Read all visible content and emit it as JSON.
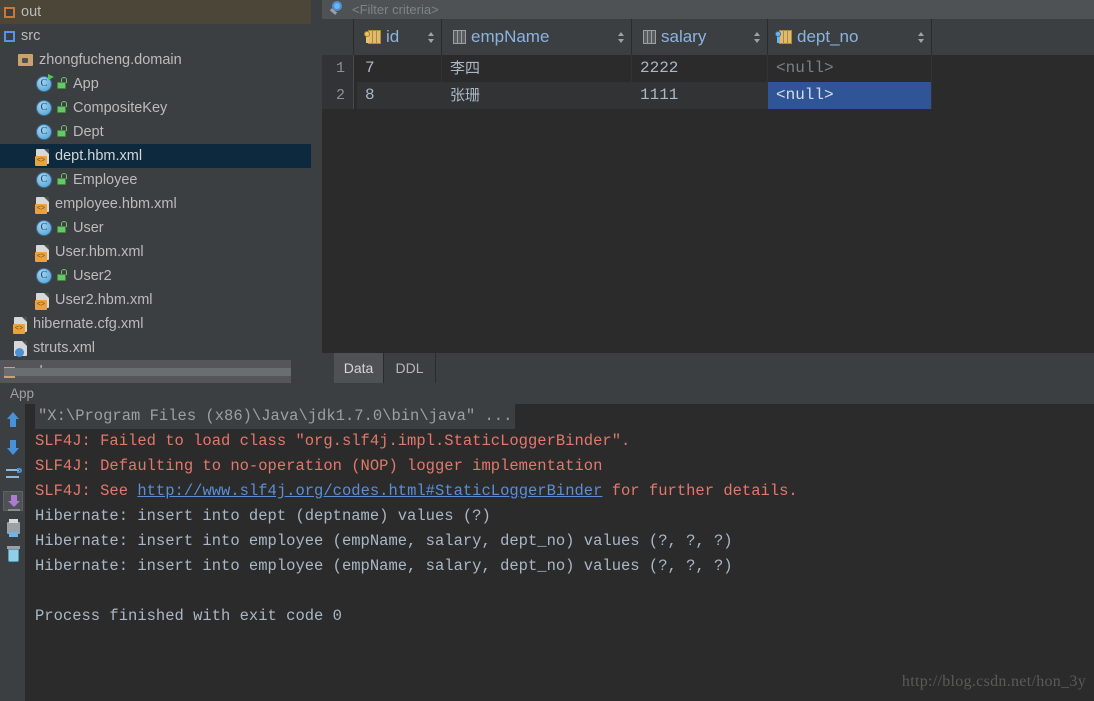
{
  "tree": {
    "items": [
      {
        "label": "out",
        "icon": "module-icon",
        "indent": 0,
        "state": "module"
      },
      {
        "label": "src",
        "icon": "module-icon-blue",
        "indent": 0,
        "state": "normal"
      },
      {
        "label": "zhongfucheng.domain",
        "icon": "package-icon",
        "indent": 14,
        "state": "normal"
      },
      {
        "label": "App",
        "icon": "java-class-runnable-icon",
        "indent": 32,
        "state": "normal"
      },
      {
        "label": "CompositeKey",
        "icon": "java-class-icon",
        "indent": 32,
        "state": "normal"
      },
      {
        "label": "Dept",
        "icon": "java-class-icon",
        "indent": 32,
        "state": "normal"
      },
      {
        "label": "dept.hbm.xml",
        "icon": "xml-file-icon",
        "indent": 32,
        "state": "selected"
      },
      {
        "label": "Employee",
        "icon": "java-class-icon",
        "indent": 32,
        "state": "normal"
      },
      {
        "label": "employee.hbm.xml",
        "icon": "xml-file-icon",
        "indent": 32,
        "state": "normal"
      },
      {
        "label": "User",
        "icon": "java-class-icon",
        "indent": 32,
        "state": "normal"
      },
      {
        "label": "User.hbm.xml",
        "icon": "xml-file-icon",
        "indent": 32,
        "state": "normal"
      },
      {
        "label": "User2",
        "icon": "java-class-icon",
        "indent": 32,
        "state": "normal"
      },
      {
        "label": "User2.hbm.xml",
        "icon": "xml-file-icon",
        "indent": 32,
        "state": "normal"
      },
      {
        "label": "hibernate.cfg.xml",
        "icon": "xml-file-icon",
        "indent": 10,
        "state": "normal"
      },
      {
        "label": "struts.xml",
        "icon": "struts-xml-file-icon",
        "indent": 10,
        "state": "normal"
      },
      {
        "label": "web",
        "icon": "module-icon-tan",
        "indent": 0,
        "state": "module2"
      }
    ]
  },
  "grid": {
    "filter": {
      "placeholder": "<Filter criteria>",
      "value": ""
    },
    "columns": [
      {
        "label": "id",
        "icon": "primary-key-column-icon"
      },
      {
        "label": "empName",
        "icon": "column-icon"
      },
      {
        "label": "salary",
        "icon": "column-icon"
      },
      {
        "label": "dept_no",
        "icon": "foreign-key-column-icon"
      }
    ],
    "rows": [
      {
        "num": "1",
        "id": "7",
        "empName": "李四",
        "salary": "2222",
        "dept_no": "<null>"
      },
      {
        "num": "2",
        "id": "8",
        "empName": "张珊",
        "salary": "1111",
        "dept_no": "<null>"
      }
    ],
    "selected_cell": {
      "row": 1,
      "column": "dept_no"
    },
    "tabs": [
      {
        "label": "Data",
        "active": true
      },
      {
        "label": "DDL",
        "active": false
      }
    ]
  },
  "console": {
    "title": "App",
    "toolbar": [
      {
        "icon": "arrow-up-icon",
        "name": "prev-occurrence"
      },
      {
        "icon": "arrow-down-icon",
        "name": "next-occurrence"
      },
      {
        "icon": "soft-wrap-icon",
        "name": "soft-wrap-toggle"
      },
      {
        "icon": "scroll-to-end-icon",
        "name": "scroll-to-end-toggle",
        "pressed": true
      },
      {
        "icon": "print-icon",
        "name": "print-button"
      },
      {
        "icon": "trash-icon",
        "name": "clear-all-button"
      }
    ],
    "lines": [
      {
        "text": "\"X:\\Program Files (x86)\\Java\\jdk1.7.0\\bin\\java\" ...",
        "style": "cmd"
      },
      {
        "text": "SLF4J: Failed to load class \"org.slf4j.impl.StaticLoggerBinder\".",
        "style": "err"
      },
      {
        "text": "SLF4J: Defaulting to no-operation (NOP) logger implementation",
        "style": "err"
      },
      {
        "text": "SLF4J: See ",
        "style": "err",
        "link": "http://www.slf4j.org/codes.html#StaticLoggerBinder",
        "after": " for further details."
      },
      {
        "text": "Hibernate: insert into dept (deptname) values (?)",
        "style": "plain"
      },
      {
        "text": "Hibernate: insert into employee (empName, salary, dept_no) values (?, ?, ?)",
        "style": "plain"
      },
      {
        "text": "Hibernate: insert into employee (empName, salary, dept_no) values (?, ?, ?)",
        "style": "plain"
      },
      {
        "text": "",
        "style": "plain"
      },
      {
        "text": "Process finished with exit code 0",
        "style": "plain"
      }
    ],
    "watermark": "http://blog.csdn.net/hon_3y"
  },
  "colors": {
    "background": "#3c3f41",
    "console_bg": "#2b2b2b",
    "selection": "#2f5597",
    "tree_selection": "#0d293e",
    "error_text": "#e2786c",
    "link": "#5a8fd6",
    "column_header_text": "#8cb3e0"
  }
}
